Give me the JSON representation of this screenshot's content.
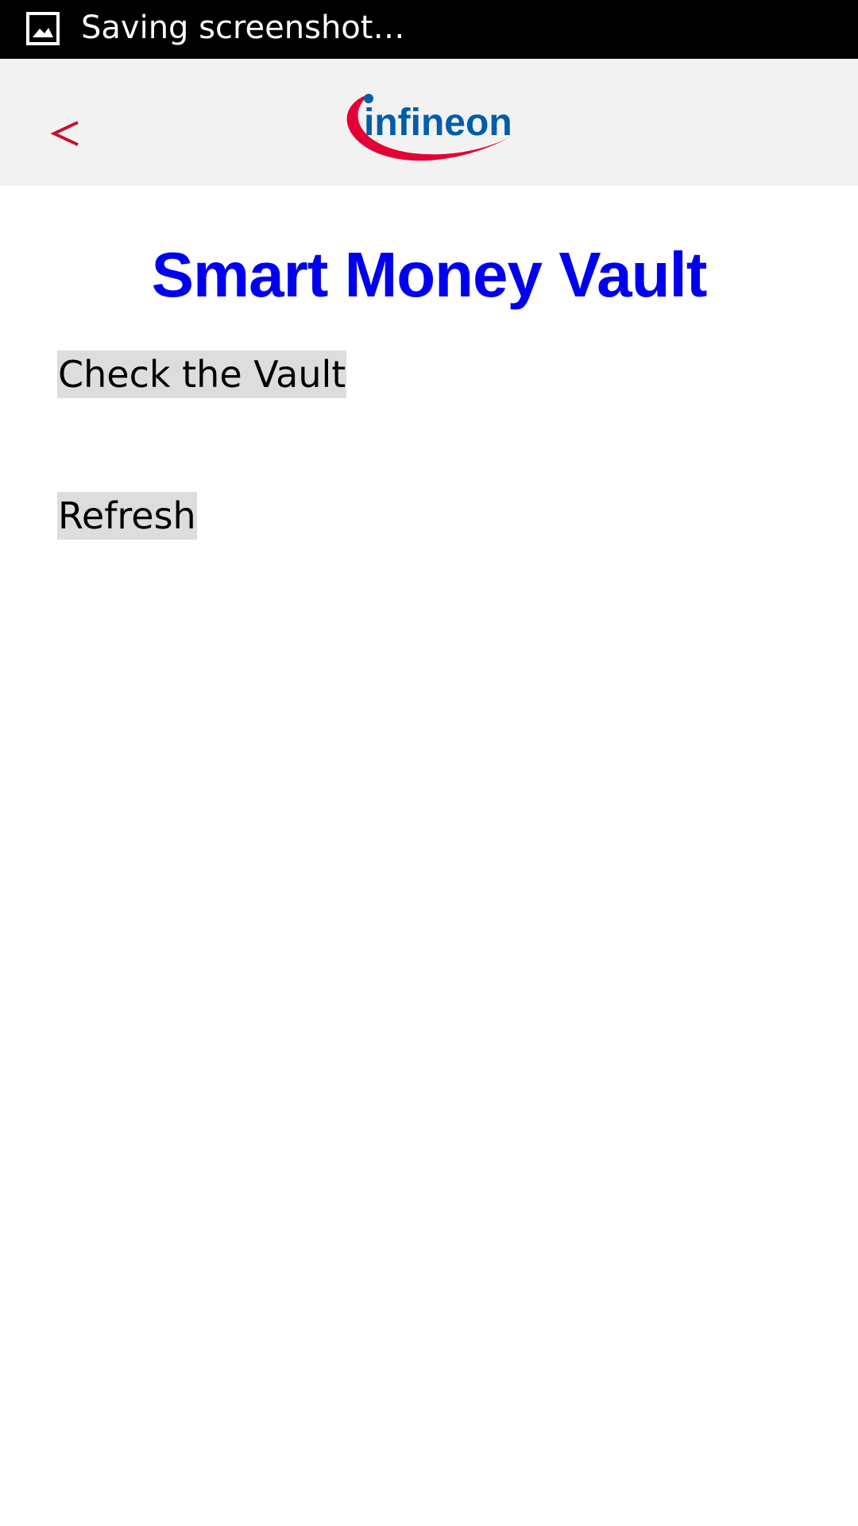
{
  "status_bar": {
    "icon": "image-icon",
    "text": "Saving screenshot…"
  },
  "header": {
    "back_label": "<",
    "logo_text": "infineon",
    "colors": {
      "back": "#c8102e",
      "logo_text": "#005da9",
      "logo_swoosh": "#e30034"
    }
  },
  "main": {
    "title": "Smart Money Vault",
    "title_color": "#0000ee",
    "check_vault_label": "Check the Vault",
    "refresh_label": "Refresh"
  }
}
